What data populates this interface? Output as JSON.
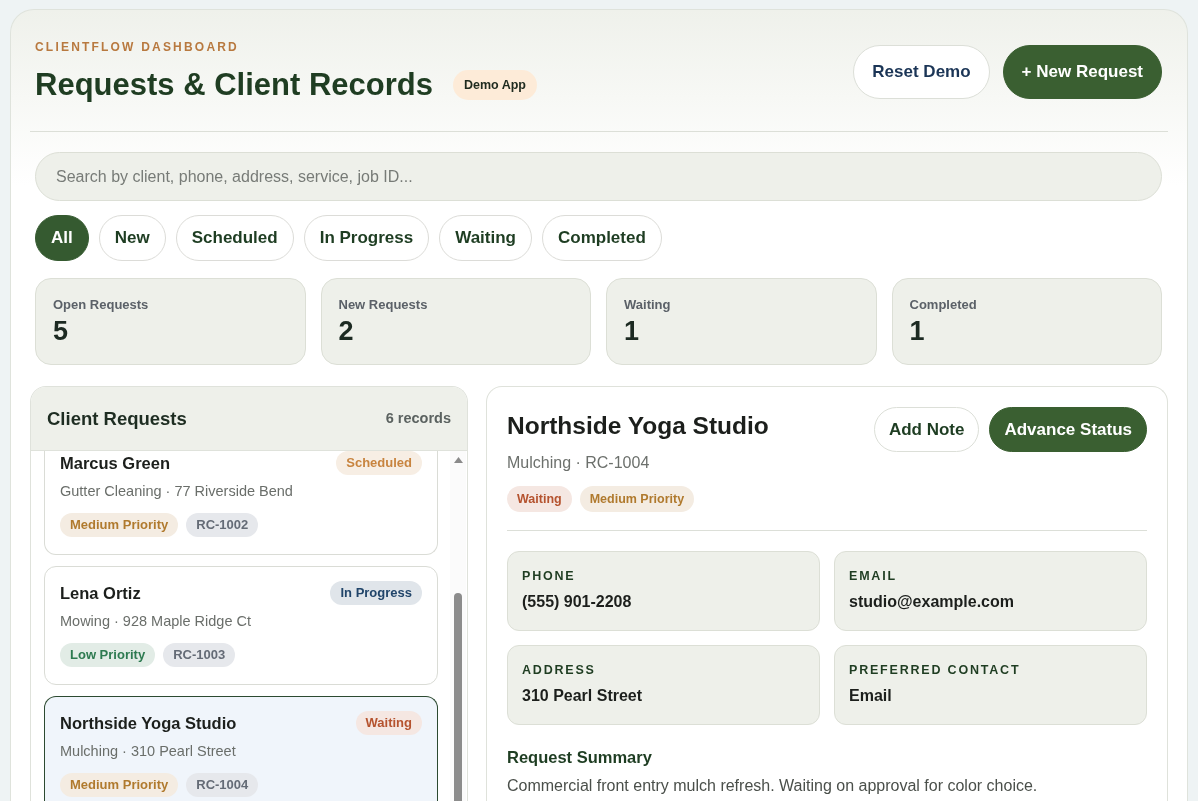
{
  "app": {
    "eyebrow": "CLIENTFLOW DASHBOARD",
    "title": "Requests & Client Records",
    "badge": "Demo App",
    "actions": [
      {
        "label": "Reset Demo",
        "kind": "secondary"
      },
      {
        "label": "+ New Request",
        "kind": "primary"
      }
    ]
  },
  "search": {
    "placeholder": "Search by client, phone, address, service, job ID..."
  },
  "filters": [
    {
      "label": "All",
      "selected": true
    },
    {
      "label": "New",
      "selected": false
    },
    {
      "label": "Scheduled",
      "selected": false
    },
    {
      "label": "In Progress",
      "selected": false
    },
    {
      "label": "Waiting",
      "selected": false
    },
    {
      "label": "Completed",
      "selected": false
    }
  ],
  "stats": [
    {
      "label": "Open Requests",
      "value": "5"
    },
    {
      "label": "New Requests",
      "value": "2"
    },
    {
      "label": "Waiting",
      "value": "1"
    },
    {
      "label": "Completed",
      "value": "1"
    }
  ],
  "requests_panel": {
    "title": "Client Requests",
    "count": "6 records",
    "scrolled": true,
    "items": [
      {
        "name": "Marcus Green",
        "status": {
          "label": "Scheduled",
          "color": "#c8843f"
        },
        "subtitle": "Gutter Cleaning · 77 Riverside Bend",
        "tags": [
          {
            "kind": "priority",
            "label": "Medium Priority",
            "color": "#b07a2e"
          },
          {
            "kind": "id",
            "label": "RC-1002"
          }
        ],
        "selected": false
      },
      {
        "name": "Lena Ortiz",
        "status": {
          "label": "In Progress",
          "color": "#21456a"
        },
        "subtitle": "Mowing · 928 Maple Ridge Ct",
        "tags": [
          {
            "kind": "priority",
            "label": "Low Priority",
            "color": "#2d7a50"
          },
          {
            "kind": "id",
            "label": "RC-1003"
          }
        ],
        "selected": false
      },
      {
        "name": "Northside Yoga Studio",
        "status": {
          "label": "Waiting",
          "color": "#b5532f"
        },
        "subtitle": "Mulching · 310 Pearl Street",
        "tags": [
          {
            "kind": "priority",
            "label": "Medium Priority",
            "color": "#b07a2e"
          },
          {
            "kind": "id",
            "label": "RC-1004"
          }
        ],
        "selected": true
      }
    ]
  },
  "detail": {
    "title": "Northside Yoga Studio",
    "subtitle": "Mulching · RC-1004",
    "status": {
      "label": "Waiting",
      "color": "#b5532f"
    },
    "priority": {
      "label": "Medium Priority",
      "color": "#b07a2e"
    },
    "actions": [
      {
        "label": "Add Note",
        "kind": "secondary"
      },
      {
        "label": "Advance Status",
        "kind": "primary"
      }
    ],
    "fields": [
      {
        "label": "PHONE",
        "value": "(555) 901-2208"
      },
      {
        "label": "EMAIL",
        "value": "studio@example.com"
      },
      {
        "label": "ADDRESS",
        "value": "310 Pearl Street"
      },
      {
        "label": "PREFERRED CONTACT",
        "value": "Email"
      }
    ],
    "summary_heading": "Request Summary",
    "summary": "Commercial front entry mulch refresh. Waiting on approval for color choice."
  }
}
